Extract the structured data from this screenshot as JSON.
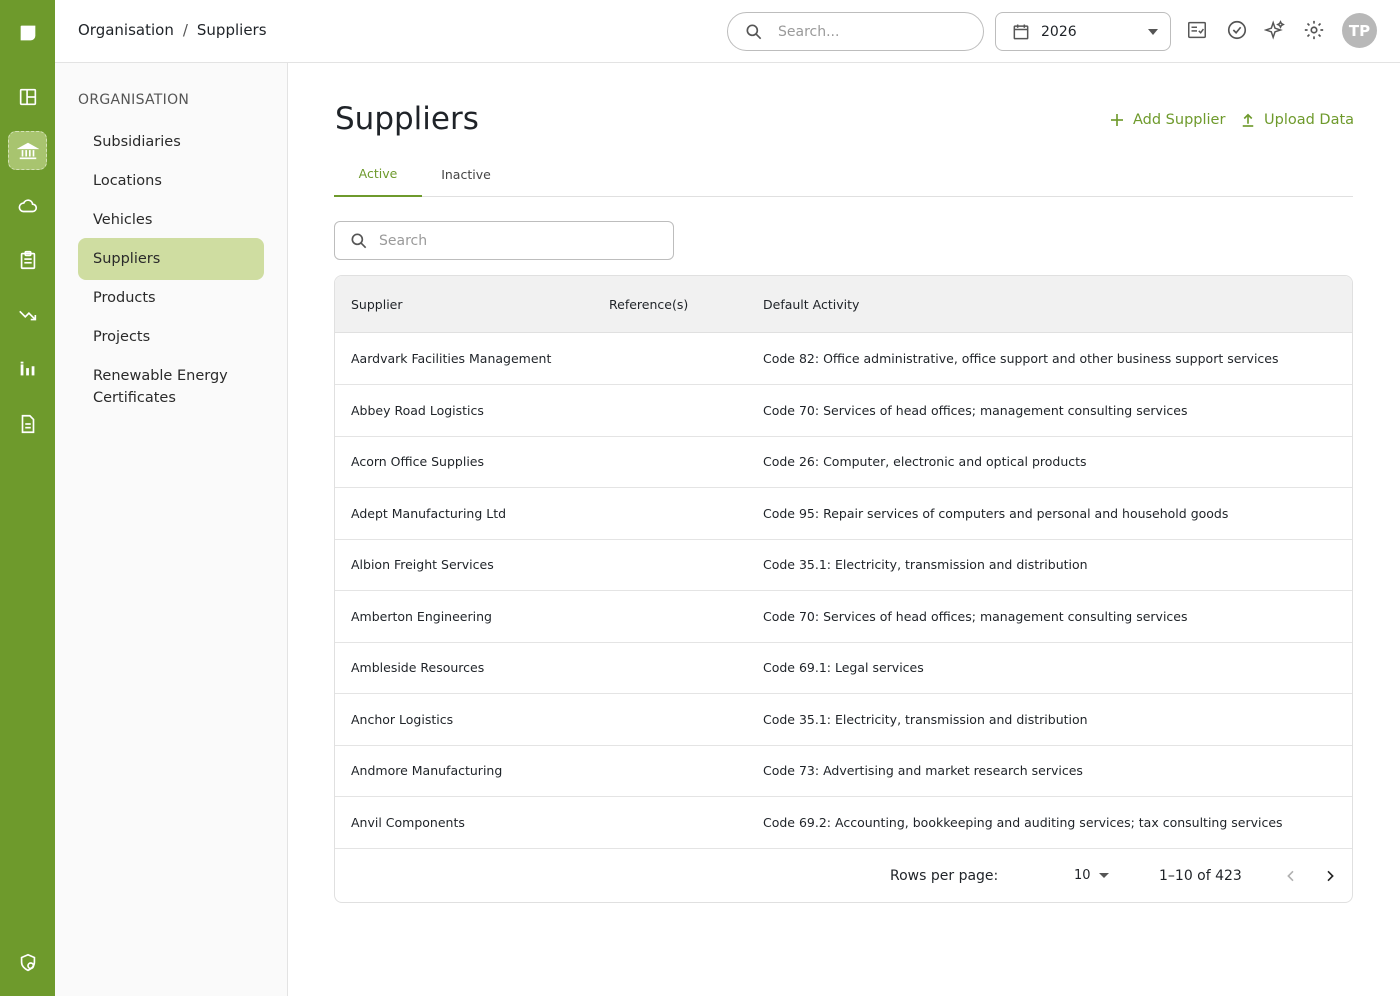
{
  "breadcrumb": {
    "root": "Organisation",
    "separator": "/",
    "current": "Suppliers"
  },
  "topbar": {
    "search_placeholder": "Search...",
    "year": "2026",
    "avatar_initials": "TP"
  },
  "subnav": {
    "heading": "ORGANISATION",
    "items": [
      {
        "label": "Subsidiaries"
      },
      {
        "label": "Locations"
      },
      {
        "label": "Vehicles"
      },
      {
        "label": "Suppliers"
      },
      {
        "label": "Products"
      },
      {
        "label": "Projects"
      },
      {
        "label": "Renewable Energy Certificates"
      }
    ]
  },
  "main": {
    "title": "Suppliers",
    "add_label": "Add Supplier",
    "upload_label": "Upload Data",
    "tabs": [
      {
        "label": "Active"
      },
      {
        "label": "Inactive"
      }
    ],
    "search_placeholder": "Search"
  },
  "table": {
    "headers": {
      "supplier": "Supplier",
      "references": "Reference(s)",
      "activity": "Default Activity"
    },
    "rows": [
      {
        "supplier": "Aardvark Facilities Management",
        "references": "",
        "activity": "Code 82: Office administrative, office support and other business support services"
      },
      {
        "supplier": "Abbey Road Logistics",
        "references": "",
        "activity": "Code 70: Services of head offices; management consulting services"
      },
      {
        "supplier": "Acorn Office Supplies",
        "references": "",
        "activity": "Code 26: Computer, electronic and optical products"
      },
      {
        "supplier": "Adept Manufacturing Ltd",
        "references": "",
        "activity": "Code 95: Repair services of computers and personal and household goods"
      },
      {
        "supplier": "Albion Freight Services",
        "references": "",
        "activity": "Code 35.1: Electricity, transmission and distribution"
      },
      {
        "supplier": "Amberton Engineering",
        "references": "",
        "activity": "Code 70: Services of head offices; management consulting services"
      },
      {
        "supplier": "Ambleside Resources",
        "references": "",
        "activity": "Code 69.1: Legal services"
      },
      {
        "supplier": "Anchor Logistics",
        "references": "",
        "activity": "Code 35.1: Electricity, transmission and distribution"
      },
      {
        "supplier": "Andmore Manufacturing",
        "references": "",
        "activity": "Code 73: Advertising and market research services"
      },
      {
        "supplier": "Anvil Components",
        "references": "",
        "activity": "Code 69.2: Accounting, bookkeeping and auditing services; tax consulting services"
      }
    ]
  },
  "pagination": {
    "rows_label": "Rows per page:",
    "rows_per_page": "10",
    "range": "1–10 of 423"
  },
  "colors": {
    "brand": "#6e9a2c",
    "active_nav": "#cfdda1"
  }
}
